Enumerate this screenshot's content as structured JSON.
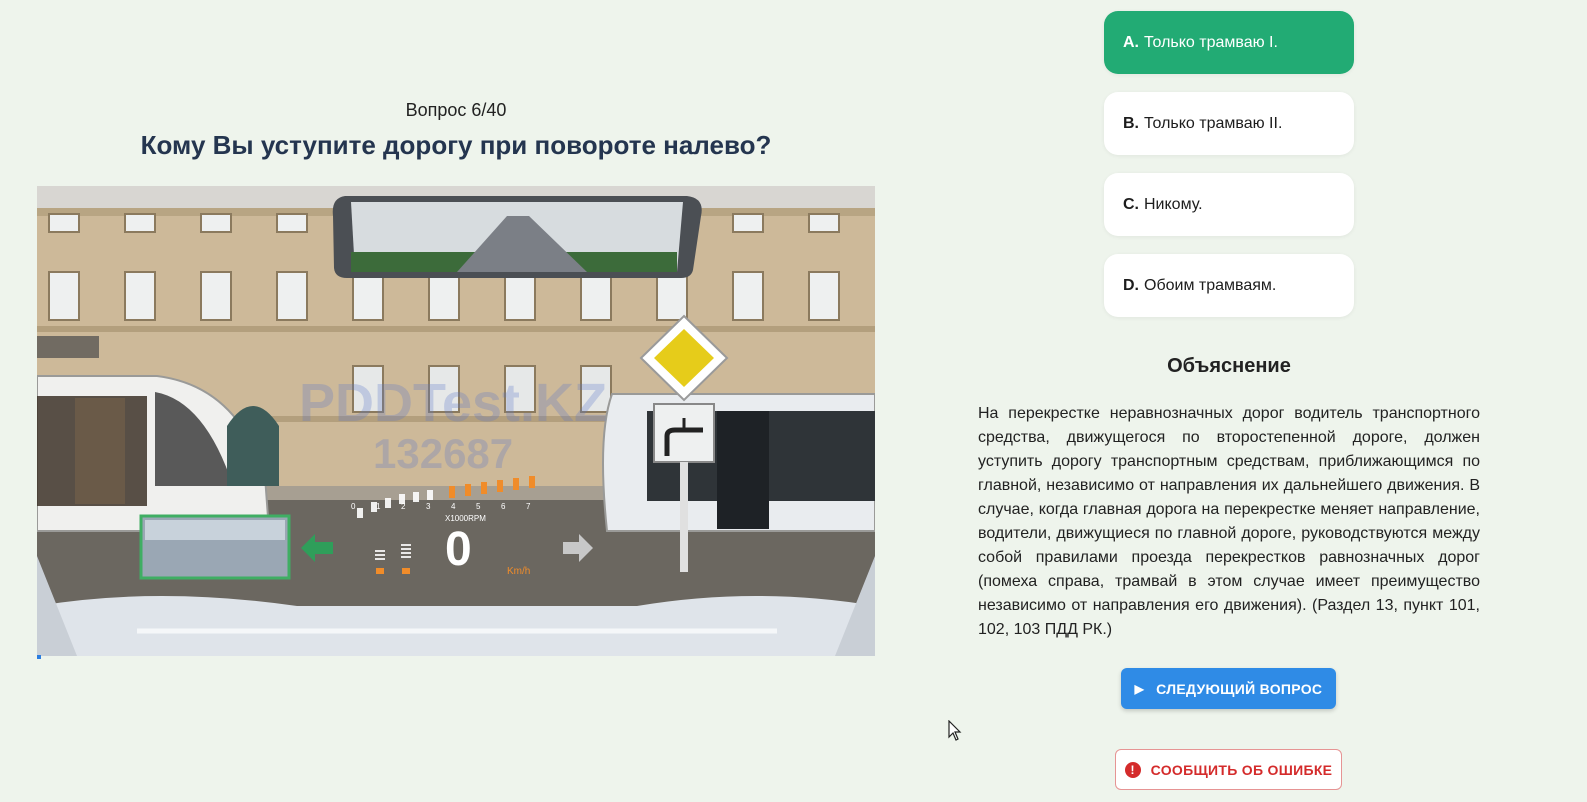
{
  "quiz": {
    "counter": "Вопрос 6/40",
    "question": "Кому Вы уступите дорогу при повороте налево?",
    "progress_percent": 0.5
  },
  "scene": {
    "watermark_line1": "PDDTest.KZ",
    "watermark_line2": "132687",
    "rpm_label": "X1000RPM",
    "speed_unit": "Km/h",
    "speed_value": "0",
    "rpm_ticks": [
      "0",
      "1",
      "2",
      "3",
      "4",
      "5",
      "6",
      "7"
    ]
  },
  "answers": [
    {
      "letter": "A.",
      "text": "Только трамваю I.",
      "selected": true
    },
    {
      "letter": "B.",
      "text": "Только трамваю II.",
      "selected": false
    },
    {
      "letter": "C.",
      "text": "Никому.",
      "selected": false
    },
    {
      "letter": "D.",
      "text": "Обоим трамваям.",
      "selected": false
    }
  ],
  "explanation": {
    "title": "Объяснение",
    "text": "На перекрестке неравнозначных дорог водитель транспортного средства, движущегося по второстепенной дороге, должен уступить дорогу транспортным средствам, приближающимся по главной, независимо от направления их дальнейшего движения. В случае, когда главная дорога на перекрестке меняет направление, водители, движущиеся по главной дороге, руководствуются между собой правилами проезда перекрестков равнозначных дорог (помеха справа, трамвай в этом случае имеет преимущество независимо от направления его движения). (Раздел 13, пункт 101, 102, 103 ПДД РК.)"
  },
  "buttons": {
    "next": "СЛЕДУЮЩИЙ ВОПРОС",
    "report": "СООБЩИТЬ ОБ ОШИБКЕ"
  },
  "colors": {
    "background": "#eef4ec",
    "selected_answer": "#22ab74",
    "primary_button": "#2f8be6",
    "danger": "#d42b2b"
  }
}
